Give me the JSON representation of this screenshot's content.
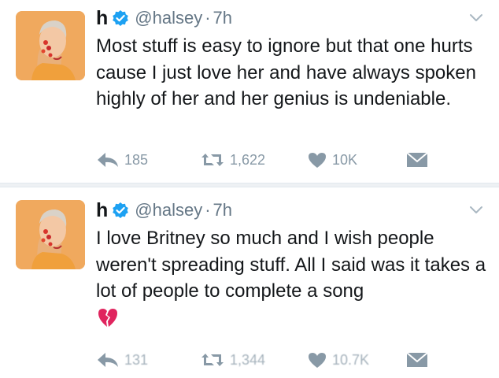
{
  "tweets": [
    {
      "name": "h",
      "handle": "@halsey",
      "separator": "·",
      "time": "7h",
      "text": "Most stuff is easy to ignore but that one hurts cause I just love her and have always spoken highly of her and her genius is undeniable.",
      "emoji": "",
      "replies": "185",
      "retweets": "1,622",
      "likes": "10K"
    },
    {
      "name": "h",
      "handle": "@halsey",
      "separator": "·",
      "time": "7h",
      "text": "I love Britney so much and I wish people weren't spreading stuff. All I said was it takes a lot of people to complete a song",
      "emoji": "broken-heart-icon",
      "replies": "131",
      "retweets": "1,344",
      "likes": "10.7K"
    }
  ],
  "icons": {
    "verified": "verified-badge-icon",
    "menu": "chevron-down-icon",
    "reply": "reply-icon",
    "retweet": "retweet-icon",
    "like": "heart-icon",
    "direct_message": "envelope-icon"
  },
  "colors": {
    "text": "#14171a",
    "secondary": "#657786",
    "action": "#8899a6",
    "verified": "#1da1f2",
    "broken_heart": "#e0245e"
  }
}
